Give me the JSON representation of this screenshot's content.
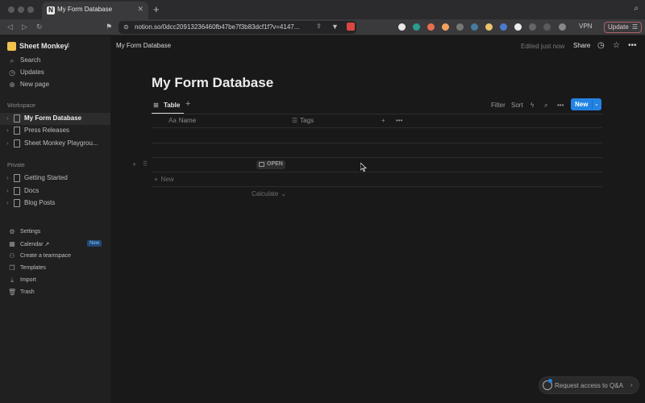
{
  "browser": {
    "tab_title": "My Form Database",
    "url": "notion.so/0dcc20913236460fb47be7f3b83dcf1f?v=4147...",
    "vpn_label": "VPN",
    "update_label": "Update"
  },
  "sidebar": {
    "workspace_name": "Sheet Monkey",
    "top_items": [
      {
        "label": "Search",
        "icon": "search-icon"
      },
      {
        "label": "Updates",
        "icon": "clock-icon"
      },
      {
        "label": "New page",
        "icon": "plus-circle-icon"
      }
    ],
    "workspace_section": "Workspace",
    "workspace_pages": [
      "My Form Database",
      "Press Releases",
      "Sheet Monkey Playgrou..."
    ],
    "private_section": "Private",
    "private_pages": [
      "Getting Started",
      "Docs",
      "Blog Posts"
    ],
    "bottom_items": [
      {
        "label": "Settings",
        "icon": "gear-icon"
      },
      {
        "label": "Calendar ↗",
        "icon": "calendar-icon",
        "badge": "New"
      },
      {
        "label": "Create a teamspace",
        "icon": "team-icon"
      },
      {
        "label": "Templates",
        "icon": "templates-icon"
      },
      {
        "label": "Import",
        "icon": "download-icon"
      },
      {
        "label": "Trash",
        "icon": "trash-icon"
      }
    ]
  },
  "topbar": {
    "breadcrumb": "My Form Database",
    "edited": "Edited just now",
    "share": "Share"
  },
  "page": {
    "title": "My Form Database",
    "view_tab": "Table",
    "toolbar": {
      "filter": "Filter",
      "sort": "Sort",
      "new": "New"
    },
    "columns": [
      {
        "glyph": "Aa",
        "label": "Name"
      },
      {
        "glyph": "☰",
        "label": "Tags"
      }
    ],
    "open_label": "OPEN",
    "new_row": "New",
    "calculate": "Calculate"
  },
  "help": {
    "label": "Request access to Q&A"
  },
  "colors": {
    "accent": "#2383e2",
    "sidebar_bg": "#202020",
    "main_bg": "#191919"
  }
}
